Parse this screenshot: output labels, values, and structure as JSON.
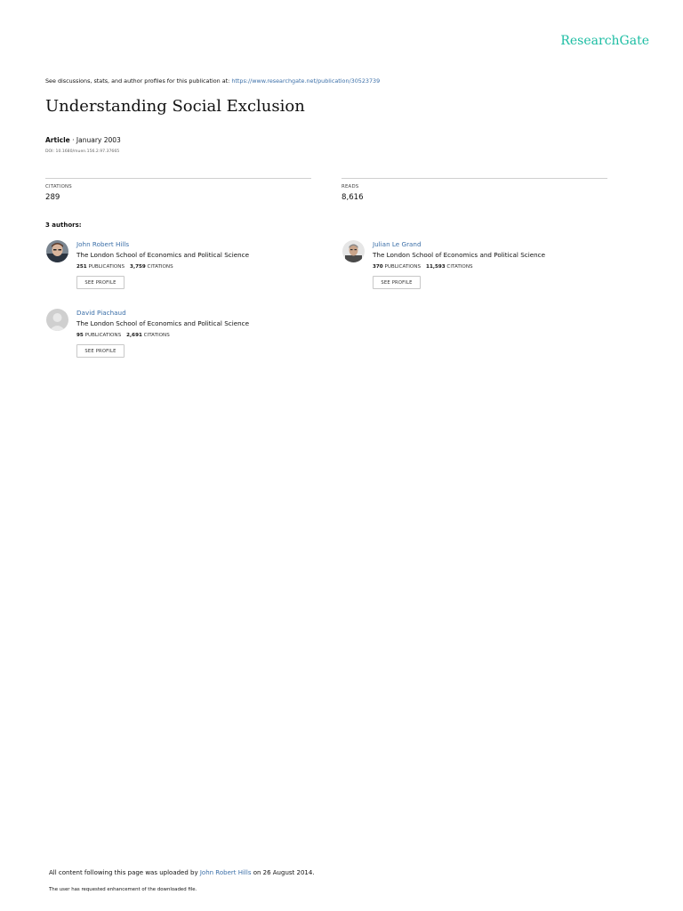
{
  "brand": {
    "logo_text": "ResearchGate",
    "accent_color": "#1cbda3",
    "link_color": "#3b6fa8"
  },
  "header": {
    "discussion_prefix": "See discussions, stats, and author profiles for this publication at: ",
    "publication_url": "https://www.researchgate.net/publication/30523739"
  },
  "article": {
    "title": "Understanding Social Exclusion",
    "type": "Article",
    "date": " · January 2003",
    "doi": "DOI: 10.1680/muen.156.2.97.37665"
  },
  "stats": {
    "citations_label": "CITATIONS",
    "citations_value": "289",
    "reads_label": "READS",
    "reads_value": "8,616"
  },
  "authors_heading": "3 authors:",
  "authors": [
    {
      "name": "John Robert Hills",
      "institution": "The London School of Economics and Political Science",
      "publications": "251",
      "citations": "3,759",
      "avatar_icon": "person-photo-icon"
    },
    {
      "name": "Julian Le Grand",
      "institution": "The London School of Economics and Political Science",
      "publications": "370",
      "citations": "11,593",
      "avatar_icon": "person-photo-icon"
    },
    {
      "name": "David Piachaud",
      "institution": "The London School of Economics and Political Science",
      "publications": "95",
      "citations": "2,691",
      "avatar_icon": "default-avatar-icon"
    }
  ],
  "labels": {
    "publications": "PUBLICATIONS",
    "citations": "CITATIONS",
    "see_profile": "SEE PROFILE"
  },
  "footer": {
    "upload_prefix": "All content following this page was uploaded by ",
    "uploader": "John Robert Hills",
    "upload_suffix": " on 26 August 2014.",
    "note": "The user has requested enhancement of the downloaded file."
  }
}
